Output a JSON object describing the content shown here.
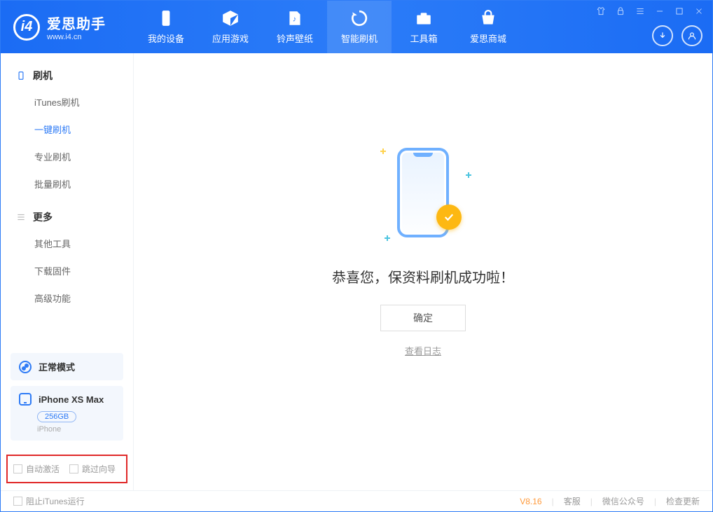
{
  "app": {
    "title": "爱思助手",
    "subtitle": "www.i4.cn"
  },
  "nav": {
    "tabs": [
      {
        "label": "我的设备"
      },
      {
        "label": "应用游戏"
      },
      {
        "label": "铃声壁纸"
      },
      {
        "label": "智能刷机"
      },
      {
        "label": "工具箱"
      },
      {
        "label": "爱思商城"
      }
    ]
  },
  "sidebar": {
    "group1": {
      "title": "刷机",
      "items": [
        "iTunes刷机",
        "一键刷机",
        "专业刷机",
        "批量刷机"
      ]
    },
    "group2": {
      "title": "更多",
      "items": [
        "其他工具",
        "下载固件",
        "高级功能"
      ]
    },
    "mode_label": "正常模式",
    "device": {
      "name": "iPhone XS Max",
      "storage": "256GB",
      "type": "iPhone"
    },
    "checkbox_auto": "自动激活",
    "checkbox_skip": "跳过向导"
  },
  "main": {
    "success_text": "恭喜您，保资料刷机成功啦！",
    "ok_button": "确定",
    "log_link": "查看日志"
  },
  "footer": {
    "block_itunes": "阻止iTunes运行",
    "version": "V8.16",
    "links": [
      "客服",
      "微信公众号",
      "检查更新"
    ]
  }
}
